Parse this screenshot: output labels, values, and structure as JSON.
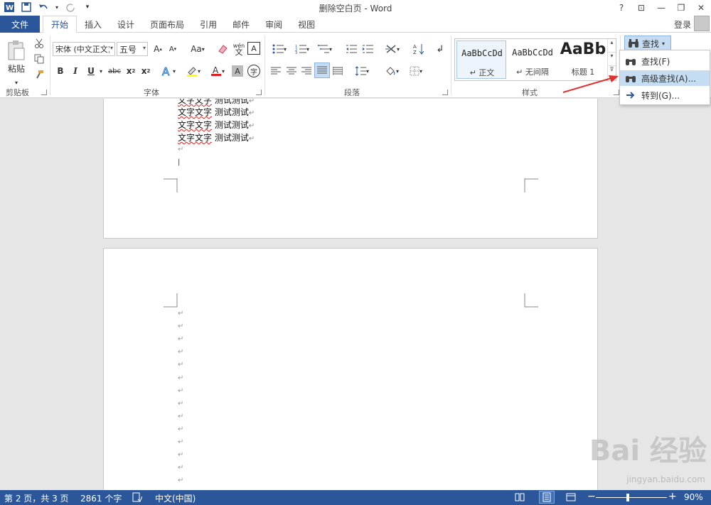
{
  "window": {
    "title": "删除空白页 - Word",
    "help": "?",
    "restore_ribbon": "⊡",
    "minimize": "—",
    "maximize": "❐",
    "close": "✕"
  },
  "tabs": {
    "file": "文件",
    "items": [
      "开始",
      "插入",
      "设计",
      "页面布局",
      "引用",
      "邮件",
      "审阅",
      "视图"
    ],
    "login": "登录"
  },
  "ribbon": {
    "clipboard": {
      "paste": "粘贴",
      "label": "剪贴板"
    },
    "font": {
      "name": "宋体 (中文正文)",
      "size": "五号",
      "label": "字体",
      "change_case": "Aa",
      "pinyin": "wén",
      "border_char": "A",
      "circle_char": "字"
    },
    "paragraph": {
      "label": "段落"
    },
    "styles": {
      "label": "样式",
      "items": [
        {
          "sample": "AaBbCcDd",
          "name": "↵ 正文"
        },
        {
          "sample": "AaBbCcDd",
          "name": "↵ 无间隔"
        },
        {
          "sample": "AaBb",
          "name": "标题 1"
        }
      ]
    },
    "editing": {
      "find": "查找"
    }
  },
  "find_menu": {
    "items": [
      "查找(F)",
      "高级查找(A)...",
      "转到(G)..."
    ]
  },
  "document": {
    "lines": [
      {
        "a": "文字文字",
        "b": "测试测试"
      },
      {
        "a": "文字文字",
        "b": "测试测试"
      },
      {
        "a": "文字文字",
        "b": "测试测试"
      },
      {
        "a": "文字文字",
        "b": "测试测试"
      }
    ],
    "para_mark": "↵"
  },
  "status": {
    "page": "第 2 页，共 3 页",
    "words": "2861 个字",
    "language": "中文(中国)",
    "zoom": "90%",
    "zoom_level": 0.45
  },
  "watermark": {
    "brand": "Bai 经验",
    "url": "jingyan.baidu.com"
  },
  "colors": {
    "accent": "#2b579a",
    "highlight": "#ffff00",
    "font_color": "#e02020",
    "annotation_arrow": "#e03030"
  }
}
